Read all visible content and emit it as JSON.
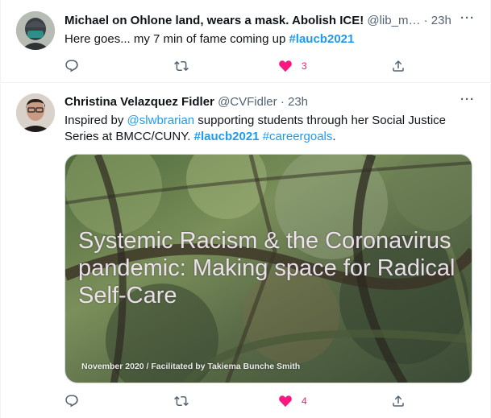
{
  "tweets": [
    {
      "author_name": "Michael on Ohlone land, wears a mask. Abolish ICE!",
      "handle": "@lib_m…",
      "time": "23h",
      "text_plain": "Here goes... my 7 min of fame coming up ",
      "hashtag": "#laucb2021",
      "like_count": "3"
    },
    {
      "author_name": "Christina Velazquez Fidler",
      "handle": "@CVFidler",
      "time": "23h",
      "text_1": "Inspired by ",
      "mention": "@slwbrarian",
      "text_2": " supporting students through her Social Justice Series at BMCC/CUNY. ",
      "hashtag_bold": "#laucb2021",
      "hashtag_2": "#careergoals",
      "text_end": ".",
      "media": {
        "title": "Systemic Racism & the Coronavirus pandemic: Making space for Radical Self-Care",
        "caption": "November 2020 / Facilitated by Takiema Bunche Smith"
      },
      "like_count": "4"
    }
  ],
  "ui": {
    "separator": "·",
    "more_glyph": "···",
    "icons": [
      "more-icon",
      "reply-icon",
      "retweet-icon",
      "heart-filled-icon",
      "share-icon"
    ],
    "colors": {
      "link": "#1d9bf0",
      "like": "#f91880",
      "muted": "#536471",
      "text": "#0f1419"
    }
  }
}
